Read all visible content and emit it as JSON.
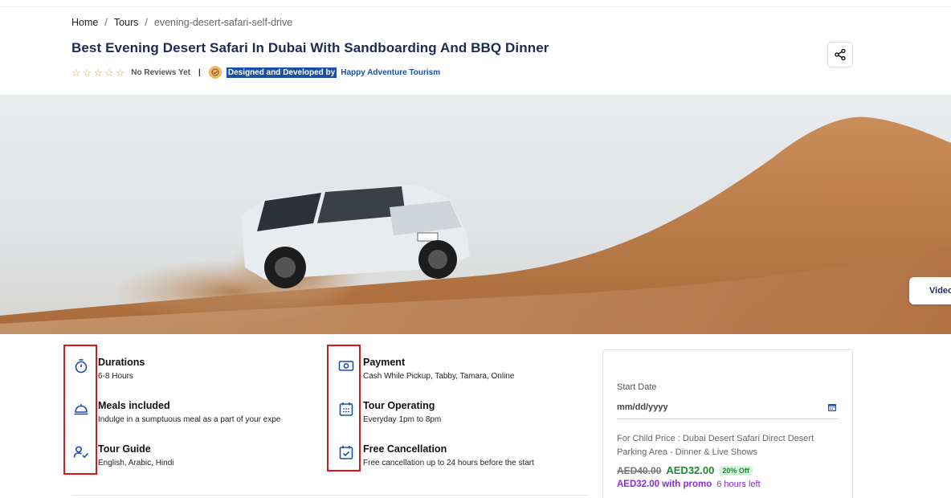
{
  "breadcrumb": {
    "home": "Home",
    "sep1": "/",
    "tours": "Tours",
    "sep2": "/",
    "current": "evening-desert-safari-self-drive"
  },
  "title": "Best Evening Desert Safari In Dubai With Sandboarding And BBQ Dinner",
  "meta": {
    "reviews": "No Reviews Yet",
    "pipe": "|",
    "designed": "Designed and Developed by",
    "company": "Happy Adventure Tourism",
    "rating_stars": 0,
    "star_color": "#e8a33a"
  },
  "hero": {
    "video_label": "Video"
  },
  "features_left": [
    {
      "icon": "stopwatch-icon",
      "title": "Durations",
      "desc": "6-8 Hours"
    },
    {
      "icon": "dish-cloche-icon",
      "title": "Meals included",
      "desc": "Indulge in a sumptuous meal as a part of your expe"
    },
    {
      "icon": "user-check-icon",
      "title": "Tour Guide",
      "desc": "English, Arabic, Hindi"
    }
  ],
  "features_right": [
    {
      "icon": "cash-icon",
      "title": "Payment",
      "desc": "Cash While Pickup, Tabby, Tamara, Online"
    },
    {
      "icon": "calendar-grid-icon",
      "title": "Tour Operating",
      "desc": "Everyday 1pm to 8pm"
    },
    {
      "icon": "calendar-check-icon",
      "title": "Free Cancellation",
      "desc": "Free cancellation up to 24 hours before the start"
    }
  ],
  "booking": {
    "start_date_label": "Start Date",
    "date_placeholder": "mm/dd/yyyy",
    "child_price_desc": "For Child Price : Dubai Desert Safari Direct Desert Parking Area - Dinner & Live Shows",
    "old_price": "AED40.00",
    "new_price": "AED32.00",
    "discount": "20% Off",
    "promo_price": "AED32.00 with promo",
    "time_left": "6 hours left"
  },
  "colors": {
    "accent": "#1b4fa6",
    "title": "#1c2a55",
    "highlight_box": "#e0141e",
    "price_green": "#1d8a2f",
    "promo_purple": "#8a2be2"
  }
}
